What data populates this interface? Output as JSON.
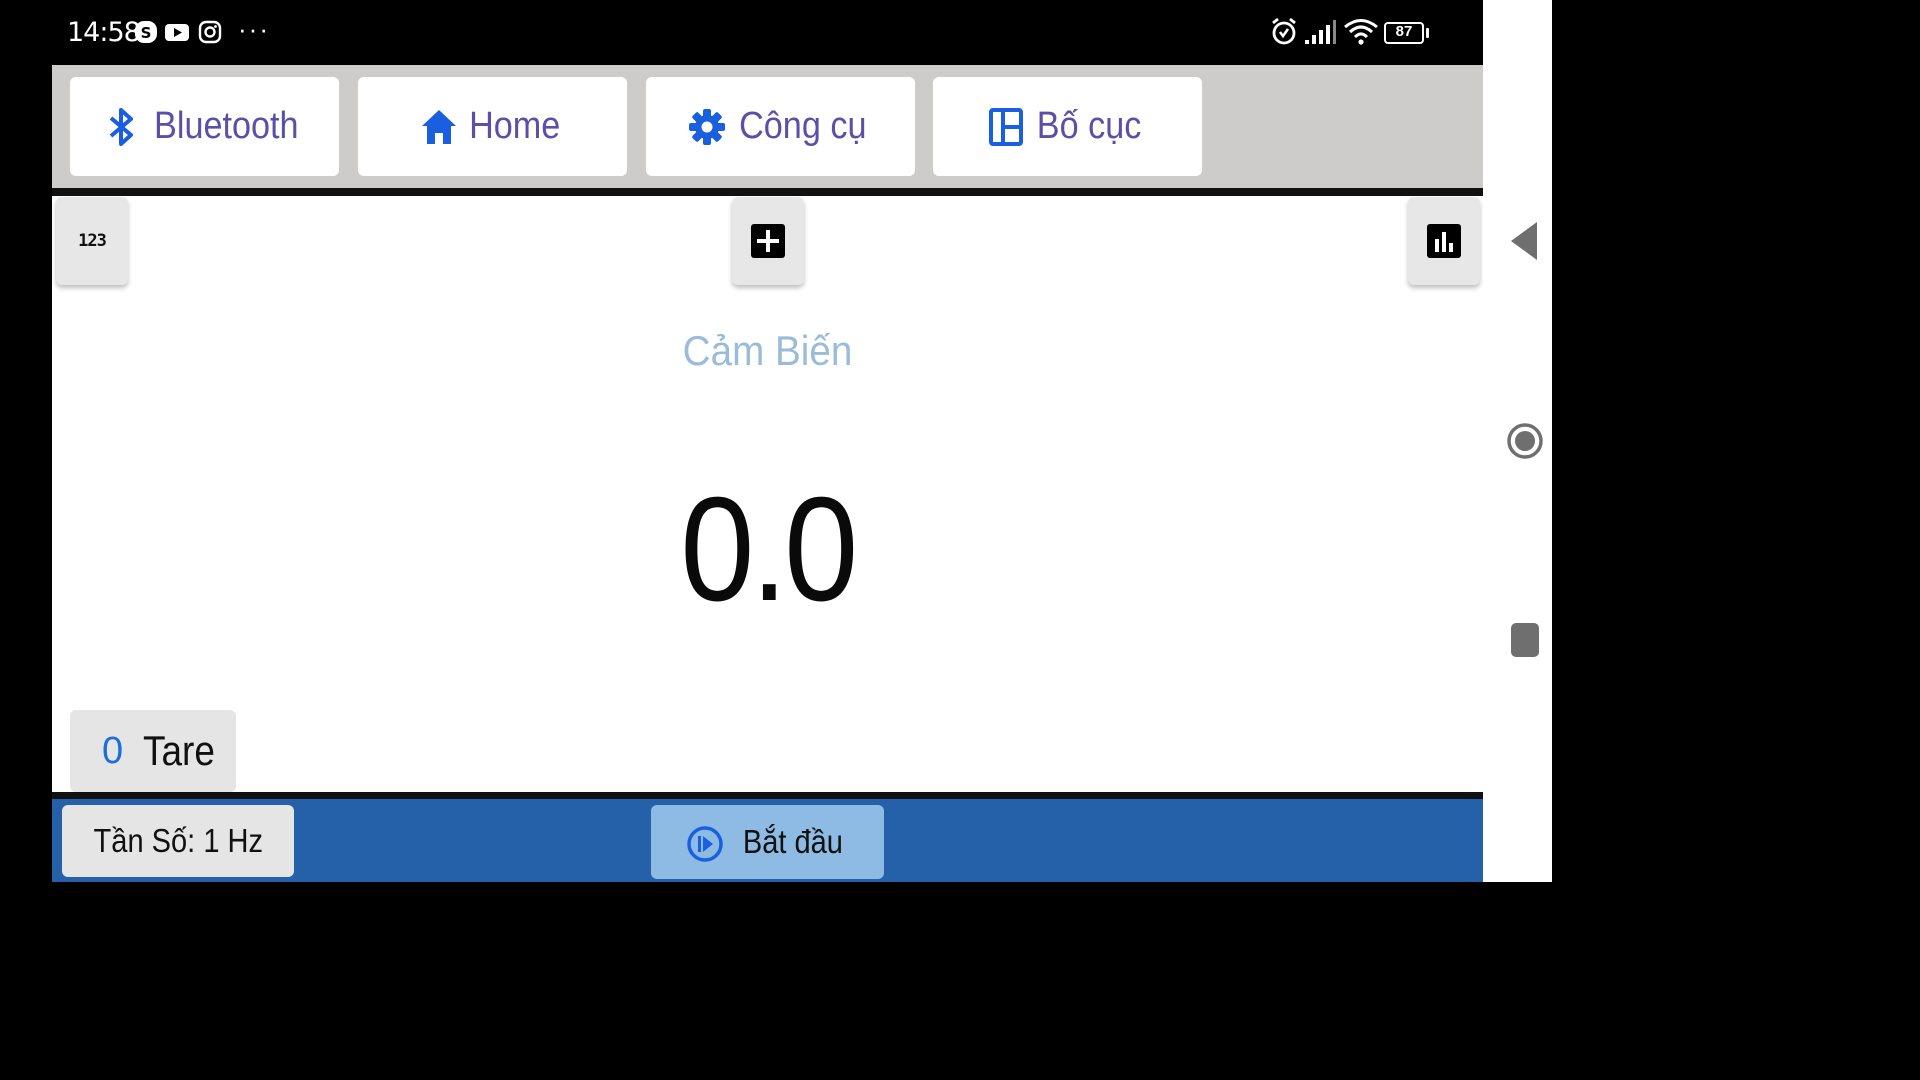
{
  "status_bar": {
    "time": "14:58",
    "left_icons": [
      "skype-icon",
      "youtube-icon",
      "instagram-icon",
      "more-dots-icon"
    ],
    "right_icons": [
      "alarm-icon",
      "signal-icon",
      "wifi-icon",
      "battery-icon"
    ],
    "battery_level": "87"
  },
  "toolbar": {
    "tabs": [
      {
        "label": "Bluetooth",
        "icon": "bluetooth-icon"
      },
      {
        "label": "Home",
        "icon": "home-icon"
      },
      {
        "label": "Công cụ",
        "icon": "gear-icon"
      },
      {
        "label": "Bố cục",
        "icon": "layout-icon"
      }
    ],
    "label_color": "#5b4fa8",
    "icon_color": "#1a5fe0"
  },
  "display": {
    "numeric_badge": "123",
    "sensor_title": "Cảm Biến",
    "reading": "0.0"
  },
  "tare": {
    "count": "0",
    "label": "Tare"
  },
  "bottom_bar": {
    "frequency": "Tần Số: 1 Hz",
    "start_label": "Bắt đầu",
    "bar_color": "#2461a8"
  },
  "nav": {
    "items": [
      "back-icon",
      "home-circle-icon",
      "recents-icon"
    ]
  }
}
